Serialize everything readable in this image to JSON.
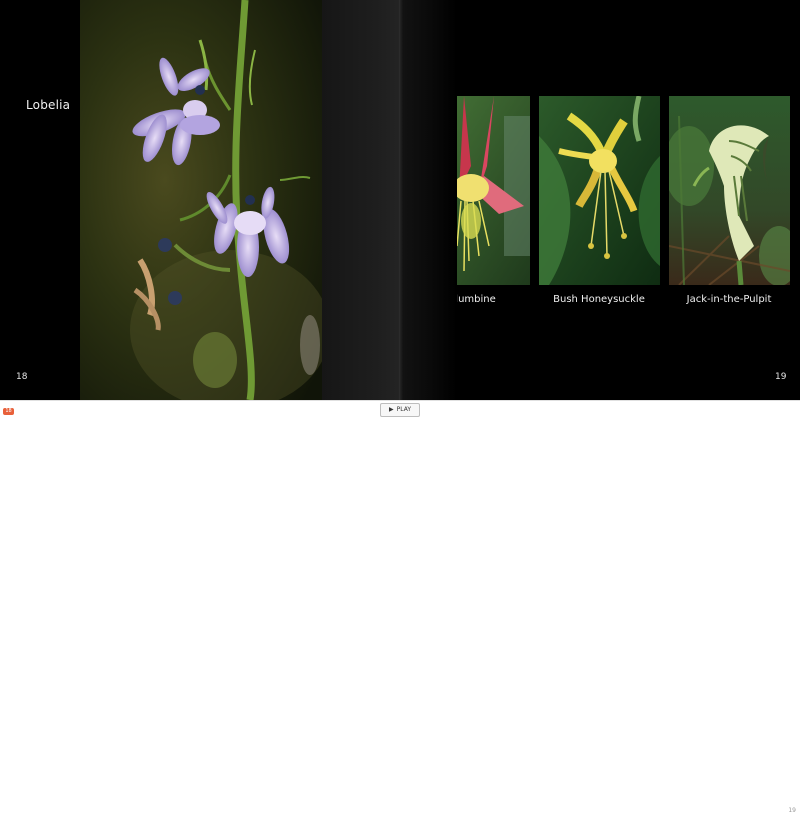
{
  "left_page": {
    "title": "Lobelia",
    "page_number": "18"
  },
  "right_page": {
    "page_number": "19",
    "photos": [
      {
        "caption": "Columbine"
      },
      {
        "caption": "Bush Honeysuckle"
      },
      {
        "caption": "Jack-in-the-Pulpit"
      }
    ]
  },
  "bottom_bar": {
    "page_badge": "18",
    "play_label": "PLAY",
    "corner_text": "19",
    "play_icon": "play-triangle-icon"
  },
  "colors": {
    "background": "#000000",
    "badge": "#e8603a"
  }
}
